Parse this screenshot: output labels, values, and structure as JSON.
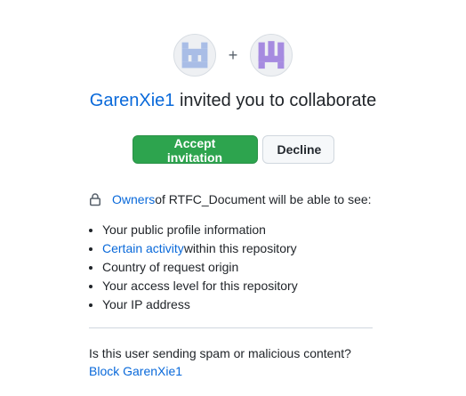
{
  "invite": {
    "inviter": "GarenXie1",
    "headline_rest": " invited you to collaborate",
    "plus": "+"
  },
  "buttons": {
    "accept": "Accept invitation",
    "decline": "Decline"
  },
  "permissions": {
    "owners_link": "Owners",
    "heading_rest": " of RTFC_Document will be able to see:",
    "items": [
      {
        "link": "",
        "text": "Your public profile information"
      },
      {
        "link": "Certain activity",
        "text": " within this repository"
      },
      {
        "link": "",
        "text": "Country of request origin"
      },
      {
        "link": "",
        "text": "Your access level for this repository"
      },
      {
        "link": "",
        "text": "Your IP address"
      }
    ]
  },
  "spam": {
    "question": "Is this user sending spam or malicious content?",
    "block_link": "Block GarenXie1"
  },
  "colors": {
    "link": "#0969da",
    "accept_bg": "#2da44e",
    "avatar_inviter": "#a9bde6",
    "avatar_user": "#a68be0"
  }
}
